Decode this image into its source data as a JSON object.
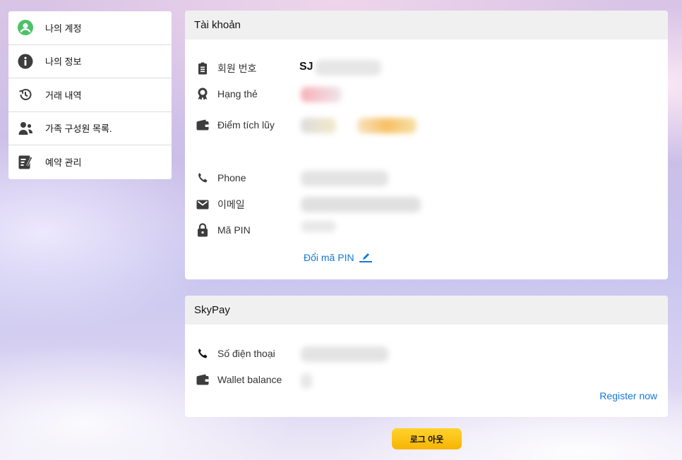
{
  "sidebar": {
    "items": [
      {
        "label": "나의 계정",
        "icon": "user-circle-icon"
      },
      {
        "label": "나의 정보",
        "icon": "info-icon"
      },
      {
        "label": "거래 내역",
        "icon": "history-icon"
      },
      {
        "label": "가족 구성원 목록.",
        "icon": "family-icon"
      },
      {
        "label": "예약 관리",
        "icon": "booking-icon"
      }
    ]
  },
  "account": {
    "title": "Tài khoản",
    "member_no_label": "회원 번호",
    "member_no_value": "SJ",
    "tier_label": "Hạng thẻ",
    "points_label": "Điểm tích lũy",
    "phone_label": "Phone",
    "email_label": "이메일",
    "pin_label": "Mã PIN",
    "change_pin": "Đổi mã PIN"
  },
  "skypay": {
    "title": "SkyPay",
    "phone_label": "Số điện thoại",
    "wallet_label": "Wallet balance",
    "register": "Register now"
  },
  "logout": "로그 아웃",
  "colors": {
    "accent_green": "#4cc268",
    "link_blue": "#1479d6",
    "logout_yellow": "#ffc915"
  }
}
